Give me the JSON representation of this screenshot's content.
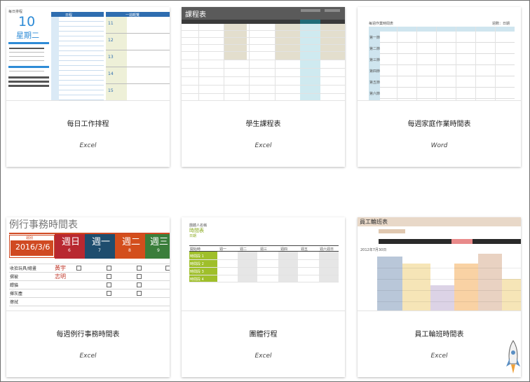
{
  "templates": [
    {
      "title": "每日工作排程",
      "app": "Excel",
      "preview": {
        "caption": "每日排程",
        "day": "10",
        "weekday": "星期二",
        "schedule_header": "日程",
        "weekly_header": "一週概覽",
        "week_days": [
          "11",
          "12",
          "13",
          "14",
          "15"
        ]
      }
    },
    {
      "title": "學生課程表",
      "app": "Excel",
      "preview": {
        "heading": "課程表"
      }
    },
    {
      "title": "每週家庭作業時間表",
      "app": "Word",
      "preview": {
        "caption": "每週作業時間表",
        "right_label": "週數：日期",
        "rows": [
          "第一節",
          "第二節",
          "第三節",
          "第四節",
          "第五節",
          "第六節"
        ]
      }
    },
    {
      "title": "每週例行事務時間表",
      "app": "Excel",
      "preview": {
        "heading": "例行事務時間表",
        "week_label": "週別",
        "date": "2016/3/6",
        "days": [
          {
            "name": "週日",
            "num": "6"
          },
          {
            "name": "週一",
            "num": "7"
          },
          {
            "name": "週二",
            "num": "8"
          },
          {
            "name": "週三",
            "num": "9"
          }
        ],
        "tasks": [
          "收拾玩具/繪畫",
          "摺被",
          "餵貓",
          "揮灰塵",
          "擦拭"
        ],
        "people": [
          "黃宇",
          "志明"
        ]
      }
    },
    {
      "title": "團體行程",
      "app": "Excel",
      "preview": {
        "subtitle": "團體人名稱",
        "heading": "時間表",
        "sub2": "日期",
        "col_header": "開始時",
        "cols": [
          "週一",
          "週二",
          "週三",
          "週四",
          "週五",
          "週六週日"
        ],
        "rows": [
          "時間段 1",
          "時間段 2",
          "時間段 3",
          "時間段 4"
        ]
      }
    },
    {
      "title": "員工輪班時間表",
      "app": "Excel",
      "preview": {
        "heading": "員工輪班表",
        "date": "2012年7月30日"
      }
    }
  ]
}
